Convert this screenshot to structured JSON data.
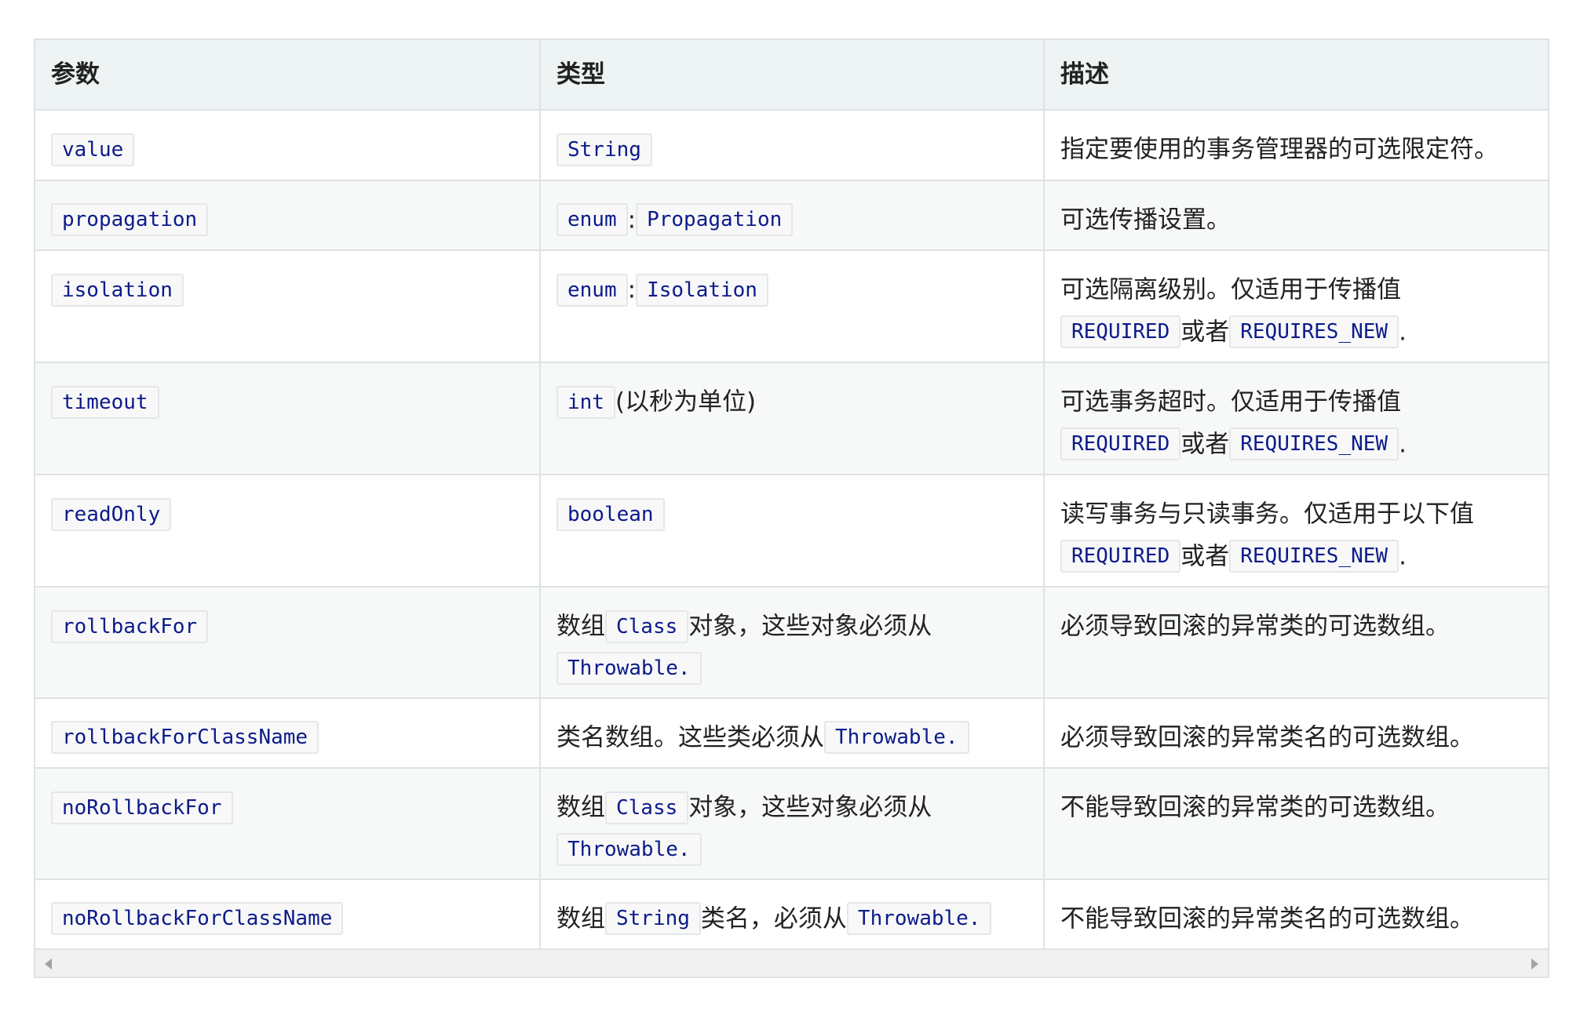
{
  "header": {
    "param": "参数",
    "type": "类型",
    "desc": "描述"
  },
  "rows": [
    {
      "param": "value",
      "type": [
        {
          "code": "String"
        }
      ],
      "desc": [
        {
          "text": "指定要使用的事务管理器的可选限定符。"
        }
      ]
    },
    {
      "param": "propagation",
      "type": [
        {
          "code": "enum"
        },
        {
          "text": ":"
        },
        {
          "code": "Propagation"
        }
      ],
      "desc": [
        {
          "text": "可选传播设置。"
        }
      ]
    },
    {
      "param": "isolation",
      "type": [
        {
          "code": "enum"
        },
        {
          "text": ":"
        },
        {
          "code": "Isolation"
        }
      ],
      "desc": [
        {
          "text": "可选隔离级别。仅适用于传播值"
        },
        {
          "br": true
        },
        {
          "code": "REQUIRED"
        },
        {
          "text": "或者"
        },
        {
          "code": "REQUIRES_NEW"
        },
        {
          "text": "."
        }
      ]
    },
    {
      "param": "timeout",
      "type": [
        {
          "code": "int"
        },
        {
          "text": "(以秒为单位)"
        }
      ],
      "desc": [
        {
          "text": "可选事务超时。仅适用于传播值"
        },
        {
          "br": true
        },
        {
          "code": "REQUIRED"
        },
        {
          "text": "或者"
        },
        {
          "code": "REQUIRES_NEW"
        },
        {
          "text": "."
        }
      ]
    },
    {
      "param": "readOnly",
      "type": [
        {
          "code": "boolean"
        }
      ],
      "desc": [
        {
          "text": "读写事务与只读事务。仅适用于以下值"
        },
        {
          "br": true
        },
        {
          "code": "REQUIRED"
        },
        {
          "text": "或者"
        },
        {
          "code": "REQUIRES_NEW"
        },
        {
          "text": "."
        }
      ]
    },
    {
      "param": "rollbackFor",
      "type": [
        {
          "text": "数组"
        },
        {
          "code": "Class"
        },
        {
          "text": "对象，这些对象必须从"
        },
        {
          "br": true
        },
        {
          "code": "Throwable."
        }
      ],
      "desc": [
        {
          "text": "必须导致回滚的异常类的可选数组。"
        }
      ]
    },
    {
      "param": "rollbackForClassName",
      "type": [
        {
          "text": "类名数组。这些类必须从"
        },
        {
          "code": "Throwable."
        }
      ],
      "desc": [
        {
          "text": "必须导致回滚的异常类名的可选数组。"
        }
      ]
    },
    {
      "param": "noRollbackFor",
      "type": [
        {
          "text": "数组"
        },
        {
          "code": "Class"
        },
        {
          "text": "对象，这些对象必须从"
        },
        {
          "br": true
        },
        {
          "code": "Throwable."
        }
      ],
      "desc": [
        {
          "text": "不能导致回滚的异常类的可选数组。"
        }
      ]
    },
    {
      "param": "noRollbackForClassName",
      "type": [
        {
          "text": "数组"
        },
        {
          "code": "String"
        },
        {
          "text": "类名，必须从"
        },
        {
          "code": "Throwable."
        }
      ],
      "desc": [
        {
          "text": "不能导致回滚的异常类名的可选数组。"
        }
      ]
    }
  ],
  "scrollbar": {
    "left_icon": "arrow-left-icon",
    "right_icon": "arrow-right-icon"
  },
  "colors": {
    "code_text": "#0b1b8a",
    "header_bg": "#eef3f3",
    "border": "#dfe2e5"
  }
}
